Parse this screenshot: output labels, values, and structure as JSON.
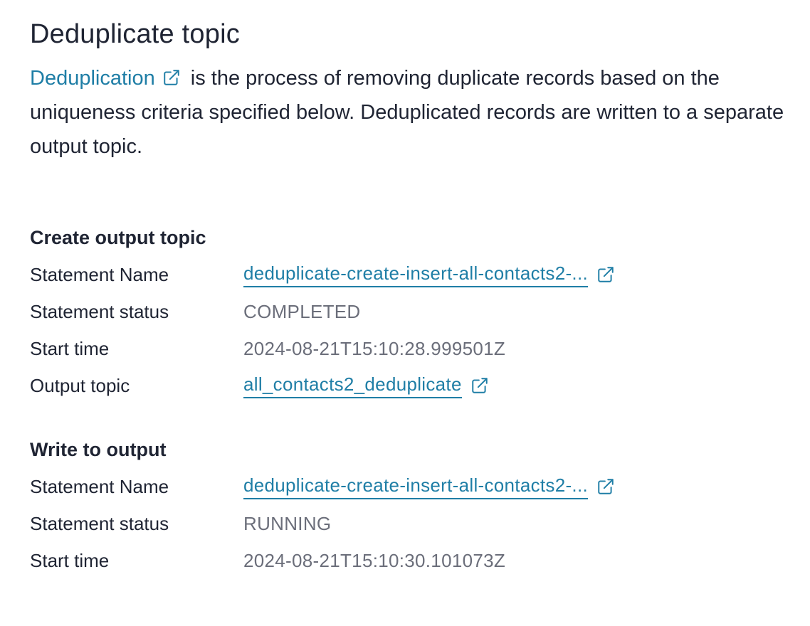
{
  "header": {
    "title": "Deduplicate topic"
  },
  "intro": {
    "link_text": "Deduplication",
    "text": " is the process of removing duplicate records based on the uniqueness criteria specified below. Deduplicated records are written to a separate output topic."
  },
  "icons": {
    "external_link": "external-link-icon"
  },
  "colors": {
    "link": "#1f7ea6",
    "text": "#1f2433",
    "muted": "#6b6e7a"
  },
  "create_output": {
    "title": "Create output topic",
    "statement_name_label": "Statement Name",
    "statement_name": "deduplicate-create-insert-all-contacts2-...",
    "status_label": "Statement status",
    "status": "COMPLETED",
    "start_time_label": "Start time",
    "start_time": "2024-08-21T15:10:28.999501Z",
    "output_topic_label": "Output topic",
    "output_topic": "all_contacts2_deduplicate"
  },
  "write_output": {
    "title": "Write to output",
    "statement_name_label": "Statement Name",
    "statement_name": "deduplicate-create-insert-all-contacts2-...",
    "status_label": "Statement status",
    "status": "RUNNING",
    "start_time_label": "Start time",
    "start_time": "2024-08-21T15:10:30.101073Z"
  }
}
